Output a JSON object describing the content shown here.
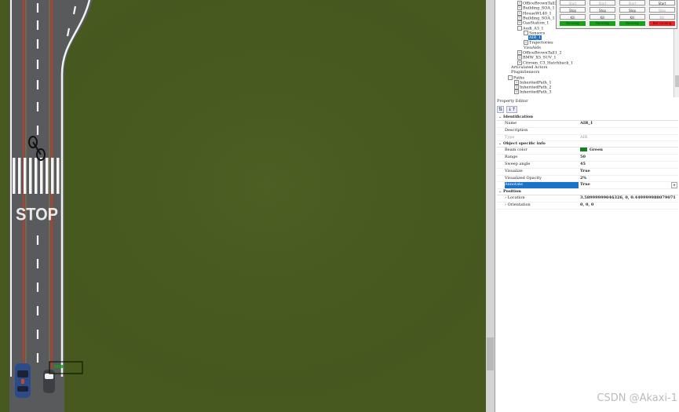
{
  "scene": {
    "road_marking_text": "STOP",
    "grass_color": "#47591f",
    "road_color": "#585a5c"
  },
  "hierarchy": {
    "nodes": [
      {
        "label": "OfficeBrownTall2_",
        "expander": "+"
      },
      {
        "label": "Building_SOA_1",
        "expander": "+"
      },
      {
        "label": "HouseWL40_1",
        "expander": "+"
      },
      {
        "label": "Building_SOA_1",
        "expander": "+"
      },
      {
        "label": "GasStation_1",
        "expander": "+"
      },
      {
        "label": "Audi_A3_1",
        "expander": "-"
      },
      {
        "label": "Sensors",
        "expander": "-"
      },
      {
        "label": "AIR_1",
        "expander": "",
        "selected": true
      },
      {
        "label": "Trajectories",
        "expander": "+"
      },
      {
        "label": "VisuAids",
        "expander": ""
      },
      {
        "label": "OfficeBrownTall1_2",
        "expander": "+"
      },
      {
        "label": "BMW_X5_SUV_1",
        "expander": "+"
      },
      {
        "label": "Citroen_C3_Hatchback_1",
        "expander": "+"
      },
      {
        "label": "Articulated Actors",
        "expander": ""
      },
      {
        "label": "PluginSensors",
        "expander": ""
      },
      {
        "label": "Paths",
        "expander": "-"
      },
      {
        "label": "InheritedPath_1",
        "expander": "+"
      },
      {
        "label": "InheritedPath_2",
        "expander": "+"
      },
      {
        "label": "InheritedPath_3",
        "expander": "+"
      }
    ]
  },
  "property_editor": {
    "title": "Property Editor",
    "toolbar": [
      "⇅",
      "↓↑"
    ],
    "categories": [
      {
        "name": "Identification",
        "rows": [
          {
            "key": "Name",
            "value": "AIR_1"
          },
          {
            "key": "Description",
            "value": ""
          },
          {
            "key": "Type",
            "value": "AIR",
            "readonly": true
          }
        ]
      },
      {
        "name": "Object specific info",
        "rows": [
          {
            "key": "Beam color",
            "value": "Green",
            "swatch": "#12821a"
          },
          {
            "key": "Range",
            "value": "50"
          },
          {
            "key": "Sweep angle",
            "value": "45"
          },
          {
            "key": "Visualize",
            "value": "True"
          },
          {
            "key": "Visualized Opacity",
            "value": "2%"
          },
          {
            "key": "Annotate",
            "value": "True",
            "highlight": true,
            "dropdown": true
          }
        ]
      },
      {
        "name": "Position",
        "rows": [
          {
            "key": "Location",
            "value": "3.58999999046326, 0, 0.449999988079071",
            "expand": true
          },
          {
            "key": "Orientation",
            "value": "0, 0, 0",
            "expand": true
          }
        ]
      }
    ]
  },
  "control_panel": {
    "start_label": "Start",
    "stop_label": "Stop",
    "kill_label": "Kill",
    "statuses": [
      {
        "label": "Running",
        "color": "#16a316"
      },
      {
        "label": "Running",
        "color": "#16a316"
      },
      {
        "label": "Running",
        "color": "#16a316"
      },
      {
        "label": "Not running",
        "color": "#ee2424"
      }
    ]
  },
  "watermark": "CSDN @Akaxi-1"
}
